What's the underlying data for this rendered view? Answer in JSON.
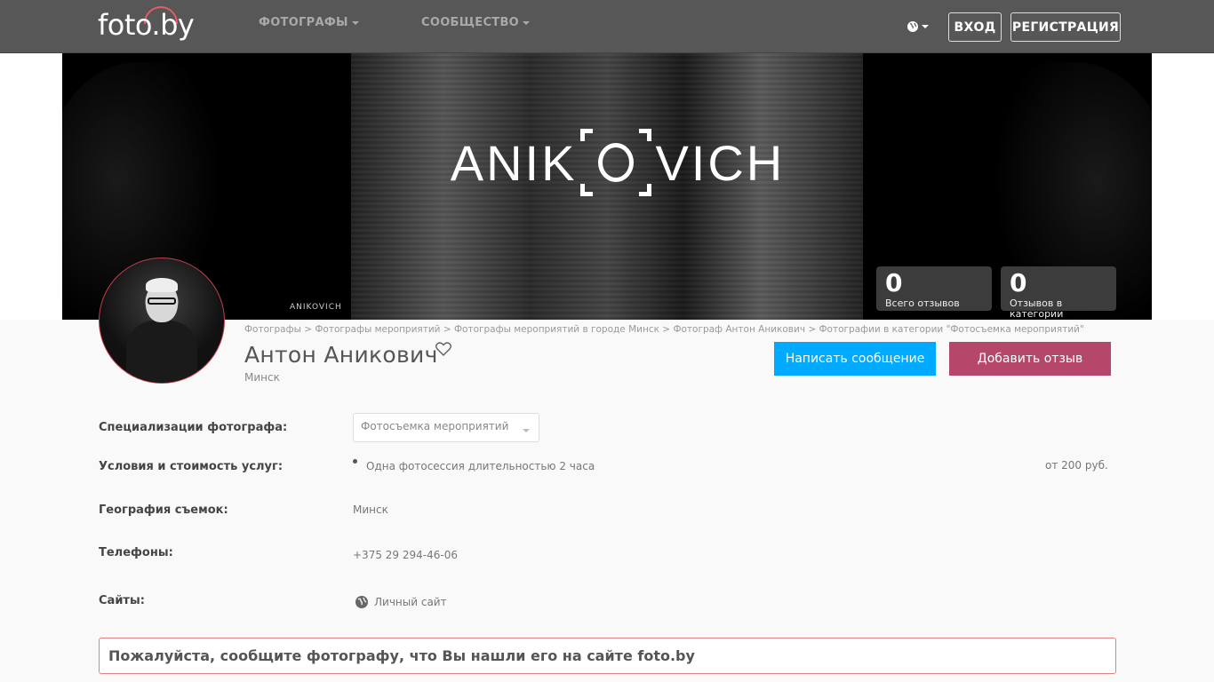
{
  "header": {
    "logo_text": "foto.by",
    "nav": [
      {
        "label": "ФОТОГРАФЫ"
      },
      {
        "label": "СООБЩЕСТВО"
      }
    ],
    "login_label": "ВХОД",
    "register_label": "РЕГИСТРАЦИЯ"
  },
  "cover": {
    "brand_left": "ANIK",
    "brand_right": "VICH",
    "brand_small": "ANIKOVICH"
  },
  "stats": [
    {
      "value": "0",
      "label": "Всего отзывов"
    },
    {
      "value": "0",
      "label": "Отзывов в категории"
    }
  ],
  "breadcrumb": [
    "Фотографы",
    "Фотографы мероприятий",
    "Фотографы мероприятий в городе Минск",
    "Фотограф Антон Аникович",
    "Фотографии в категории \"Фотосъемка мероприятий\""
  ],
  "profile": {
    "name": "Антон Аникович",
    "city": "Минск",
    "message_button": "Написать сообщение",
    "review_button": "Добавить отзыв"
  },
  "info": {
    "specializations_label": "Специализации фотографа:",
    "specializations_value": "Фотосъемка мероприятий",
    "conditions_label": "Условия и стоимость услуг:",
    "conditions_item": "Одна фотосессия длительностью 2 часа",
    "conditions_price": "от 200 руб.",
    "geo_label": "География съемок:",
    "geo_value": "Минск",
    "phones_label": "Телефоны:",
    "phones_value": "+375 29 294-46-06",
    "sites_label": "Сайты:",
    "sites_value": "Личный сайт"
  },
  "notice": "Пожалуйста, сообщите фотографу, что Вы нашли его на сайте foto.by",
  "colors": {
    "topbar": "#575757",
    "accent_blue": "#00aaff",
    "accent_review": "#b5486a",
    "logo_arc": "#e35c6a"
  }
}
